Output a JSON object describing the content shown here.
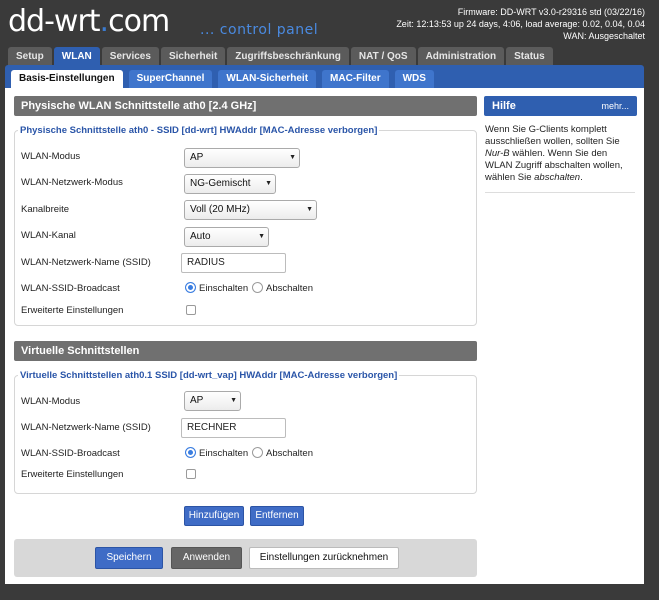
{
  "header": {
    "logo_main": "dd-wrt",
    "logo_dot": ".",
    "logo_tld": "com",
    "logo_sub": "... control panel",
    "firmware": "Firmware: DD-WRT v3.0-r29316 std (03/22/16)",
    "time": "Zeit: 12:13:53 up 24 days, 4:06, load average: 0.02, 0.04, 0.04",
    "wan": "WAN: Ausgeschaltet"
  },
  "main_tabs": [
    "Setup",
    "WLAN",
    "Services",
    "Sicherheit",
    "Zugriffsbeschränkung",
    "NAT / QoS",
    "Administration",
    "Status"
  ],
  "sub_tabs": [
    "Basis-Einstellungen",
    "SuperChannel",
    "WLAN-Sicherheit",
    "MAC-Filter",
    "WDS"
  ],
  "physical": {
    "title": "Physische WLAN Schnittstelle ath0 [2.4 GHz]",
    "legend": "Physische Schnittstelle ath0 - SSID [dd-wrt] HWAddr [MAC-Adresse verborgen]",
    "mode_label": "WLAN-Modus",
    "mode_value": "AP",
    "netmode_label": "WLAN-Netzwerk-Modus",
    "netmode_value": "NG-Gemischt",
    "channel_width_label": "Kanalbreite",
    "channel_width_value": "Voll (20 MHz)",
    "channel_label": "WLAN-Kanal",
    "channel_value": "Auto",
    "ssid_label": "WLAN-Netzwerk-Name (SSID)",
    "ssid_value": "RADIUS",
    "broadcast_label": "WLAN-SSID-Broadcast",
    "broadcast_on": "Einschalten",
    "broadcast_off": "Abschalten",
    "advanced_label": "Erweiterte Einstellungen"
  },
  "virtual": {
    "title": "Virtuelle Schnittstellen",
    "legend": "Virtuelle Schnittstellen ath0.1 SSID [dd-wrt_vap] HWAddr [MAC-Adresse verborgen]",
    "mode_label": "WLAN-Modus",
    "mode_value": "AP",
    "ssid_label": "WLAN-Netzwerk-Name (SSID)",
    "ssid_value": "RECHNER",
    "broadcast_label": "WLAN-SSID-Broadcast",
    "broadcast_on": "Einschalten",
    "broadcast_off": "Abschalten",
    "advanced_label": "Erweiterte Einstellungen",
    "add_label": "Hinzufügen",
    "remove_label": "Entfernen"
  },
  "actions": {
    "save": "Speichern",
    "apply": "Anwenden",
    "reset": "Einstellungen zurücknehmen"
  },
  "help": {
    "title": "Hilfe",
    "more": "mehr...",
    "text_1": "Wenn Sie G-Clients komplett ausschließen wollen, sollten Sie ",
    "text_em1": "Nur-B",
    "text_2": " wählen. Wenn Sie den WLAN Zugriff abschalten wollen, wählen Sie ",
    "text_em2": "abschalten",
    "text_3": "."
  },
  "colors": {
    "accent_blue": "#2f5fb0",
    "header_bg": "#3a3a3a"
  }
}
